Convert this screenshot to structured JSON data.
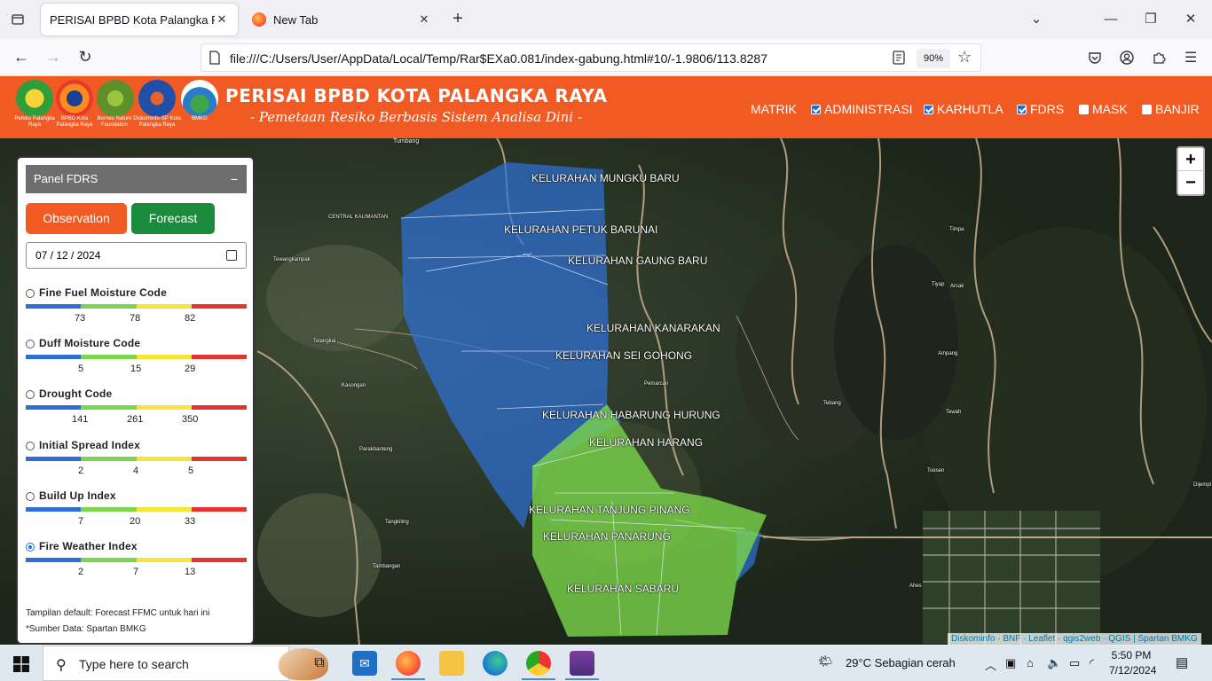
{
  "browser": {
    "tabs": [
      {
        "title": "PERISAI BPBD Kota Palangka Raya",
        "active": true
      },
      {
        "title": "New Tab",
        "active": false
      }
    ],
    "url": "file:///C:/Users/User/AppData/Local/Temp/Rar$EXa0.081/index-gabung.html#10/-1.9806/113.8287",
    "zoom": "90%"
  },
  "header": {
    "title": "PERISAI BPBD KOTA PALANGKA RAYA",
    "subtitle": "- Pemetaan Resiko Berbasis Sistem Analisa Dini -",
    "logos": [
      {
        "caption": "Pemko Palangka Raya",
        "color": "#2e9e3a"
      },
      {
        "caption": "BPBD Kota Palangka Raya",
        "color": "#e53b2c"
      },
      {
        "caption": "Borneo Nature Foundation",
        "color": "#5d8f2a"
      },
      {
        "caption": "Diskominfo-SP Kota Palangka Raya",
        "color": "#1f4fa8"
      },
      {
        "caption": "BMKG",
        "color": "#2a7cc7"
      }
    ],
    "menu": [
      {
        "label": "MATRIK",
        "checkbox": false,
        "checked": false
      },
      {
        "label": "ADMINISTRASI",
        "checkbox": true,
        "checked": true
      },
      {
        "label": "KARHUTLA",
        "checkbox": true,
        "checked": true
      },
      {
        "label": "FDRS",
        "checkbox": true,
        "checked": true
      },
      {
        "label": "MASK",
        "checkbox": true,
        "checked": false
      },
      {
        "label": "BANJIR",
        "checkbox": true,
        "checked": false
      }
    ]
  },
  "panel": {
    "title": "Panel FDRS",
    "collapse": "−",
    "observation_label": "Observation",
    "forecast_label": "Forecast",
    "date_value": "07 / 12 / 2024",
    "indices": [
      {
        "label": "Fine Fuel Moisture Code",
        "ticks": [
          "73",
          "78",
          "82"
        ],
        "selected": false
      },
      {
        "label": "Duff Moisture Code",
        "ticks": [
          "5",
          "15",
          "29"
        ],
        "selected": false
      },
      {
        "label": "Drought Code",
        "ticks": [
          "141",
          "261",
          "350"
        ],
        "selected": false
      },
      {
        "label": "Initial Spread Index",
        "ticks": [
          "2",
          "4",
          "5"
        ],
        "selected": false
      },
      {
        "label": "Build Up Index",
        "ticks": [
          "7",
          "20",
          "33"
        ],
        "selected": false
      },
      {
        "label": "Fire Weather Index",
        "ticks": [
          "2",
          "7",
          "13"
        ],
        "selected": true
      }
    ],
    "scale_colors": [
      "#2e6fd6",
      "#7ad64a",
      "#f5e63a",
      "#e3342f"
    ],
    "note_default": "Tampilan default: Forecast FFMC untuk hari ini",
    "note_source": "*Sumber Data: Spartan BMKG"
  },
  "map": {
    "zoom_in": "+",
    "zoom_out": "−",
    "attribution": "Diskominfo · BNF · Leaflet · qgis2web · QGIS | Spartan BMKG",
    "kelurahan": [
      "KELURAHAN MUNGKU BARU",
      "KELURAHAN PETUK BARUNAI",
      "KELURAHAN GAUNG BARU",
      "KELURAHAN KANARAKAN",
      "KELURAHAN SEI GOHONG",
      "KELURAHAN HABARUNG HURUNG",
      "KELURAHAN HARANG",
      "KELURAHAN TANJUNG PINANG",
      "KELURAHAN PANARUNG",
      "KELURAHAN SABARU"
    ],
    "place_names": [
      "Tumbang",
      "CENTRAL KALIMANTAN",
      "Tewangkampak",
      "Telangkai",
      "Kasongan",
      "Parakbanteng",
      "Tangkiling",
      "Tambangan",
      "Tiyap",
      "Timpa",
      "Arcak",
      "Ampang",
      "Pemarcan",
      "Tebang",
      "Tewah",
      "Toesen",
      "Dijempl",
      "Ahes"
    ],
    "fdrs_colors": {
      "low": "#2e6fd6",
      "moderate": "#7ad64a"
    }
  },
  "taskbar": {
    "search_placeholder": "Type here to search",
    "weather": "29°C  Sebagian cerah",
    "time": "5:50 PM",
    "date": "7/12/2024"
  }
}
